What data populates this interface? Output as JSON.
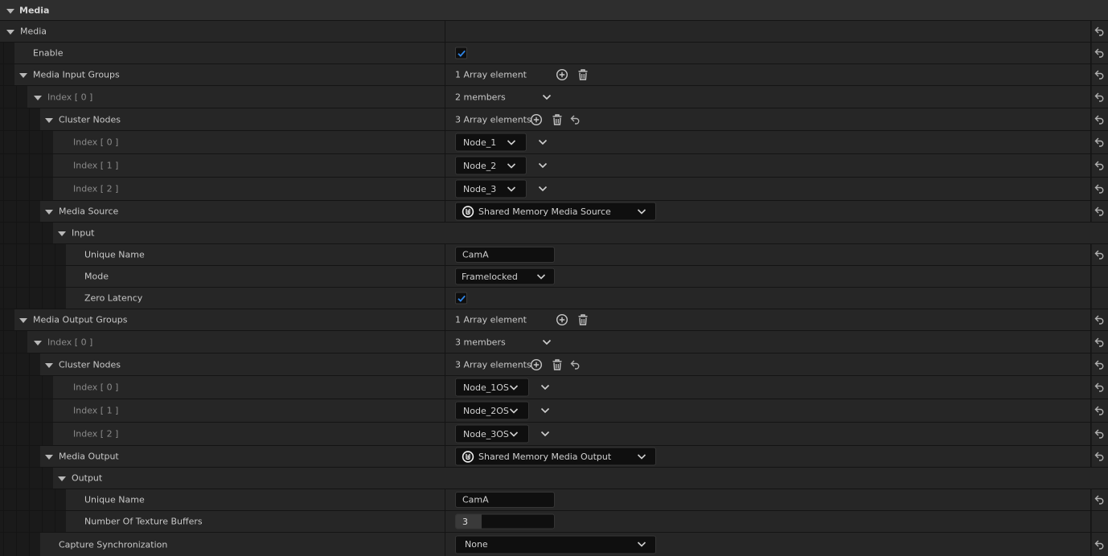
{
  "section_header": "Media",
  "rows": {
    "media": "Media",
    "enable": "Enable",
    "input_groups": {
      "label": "Media Input Groups",
      "value": "1 Array element"
    },
    "in_index0": {
      "label": "Index [ 0 ]",
      "value": "2 members"
    },
    "in_cluster": {
      "label": "Cluster Nodes",
      "value": "3 Array elements"
    },
    "in_nodes": [
      {
        "label": "Index [ 0 ]",
        "value": "Node_1"
      },
      {
        "label": "Index [ 1 ]",
        "value": "Node_2"
      },
      {
        "label": "Index [ 2 ]",
        "value": "Node_3"
      }
    ],
    "media_source": {
      "label": "Media Source",
      "value": "Shared Memory Media Source"
    },
    "input": "Input",
    "in_unique_name": {
      "label": "Unique Name",
      "value": "CamA"
    },
    "mode": {
      "label": "Mode",
      "value": "Framelocked"
    },
    "zero_latency": "Zero Latency",
    "output_groups": {
      "label": "Media Output Groups",
      "value": "1 Array element"
    },
    "out_index0": {
      "label": "Index [ 0 ]",
      "value": "3 members"
    },
    "out_cluster": {
      "label": "Cluster Nodes",
      "value": "3 Array elements"
    },
    "out_nodes": [
      {
        "label": "Index [ 0 ]",
        "value": "Node_1OS"
      },
      {
        "label": "Index [ 1 ]",
        "value": "Node_2OS"
      },
      {
        "label": "Index [ 2 ]",
        "value": "Node_3OS"
      }
    ],
    "media_output": {
      "label": "Media Output",
      "value": "Shared Memory Media Output"
    },
    "output": "Output",
    "out_unique_name": {
      "label": "Unique Name",
      "value": "CamA"
    },
    "texture_buffers": {
      "label": "Number Of Texture Buffers",
      "value": "3"
    },
    "capture_sync": {
      "label": "Capture Synchronization",
      "value": "None"
    }
  },
  "icons": {
    "expand": "triangle-down-icon",
    "reset": "reset-arrow-icon",
    "add": "plus-circle-icon",
    "delete": "trash-icon",
    "checked": "checkmark-icon",
    "asset": "unreal-logo-icon"
  },
  "colors": {
    "checkmark": "#2f86e8",
    "panel": "#262626",
    "header": "#2e2e2e"
  }
}
